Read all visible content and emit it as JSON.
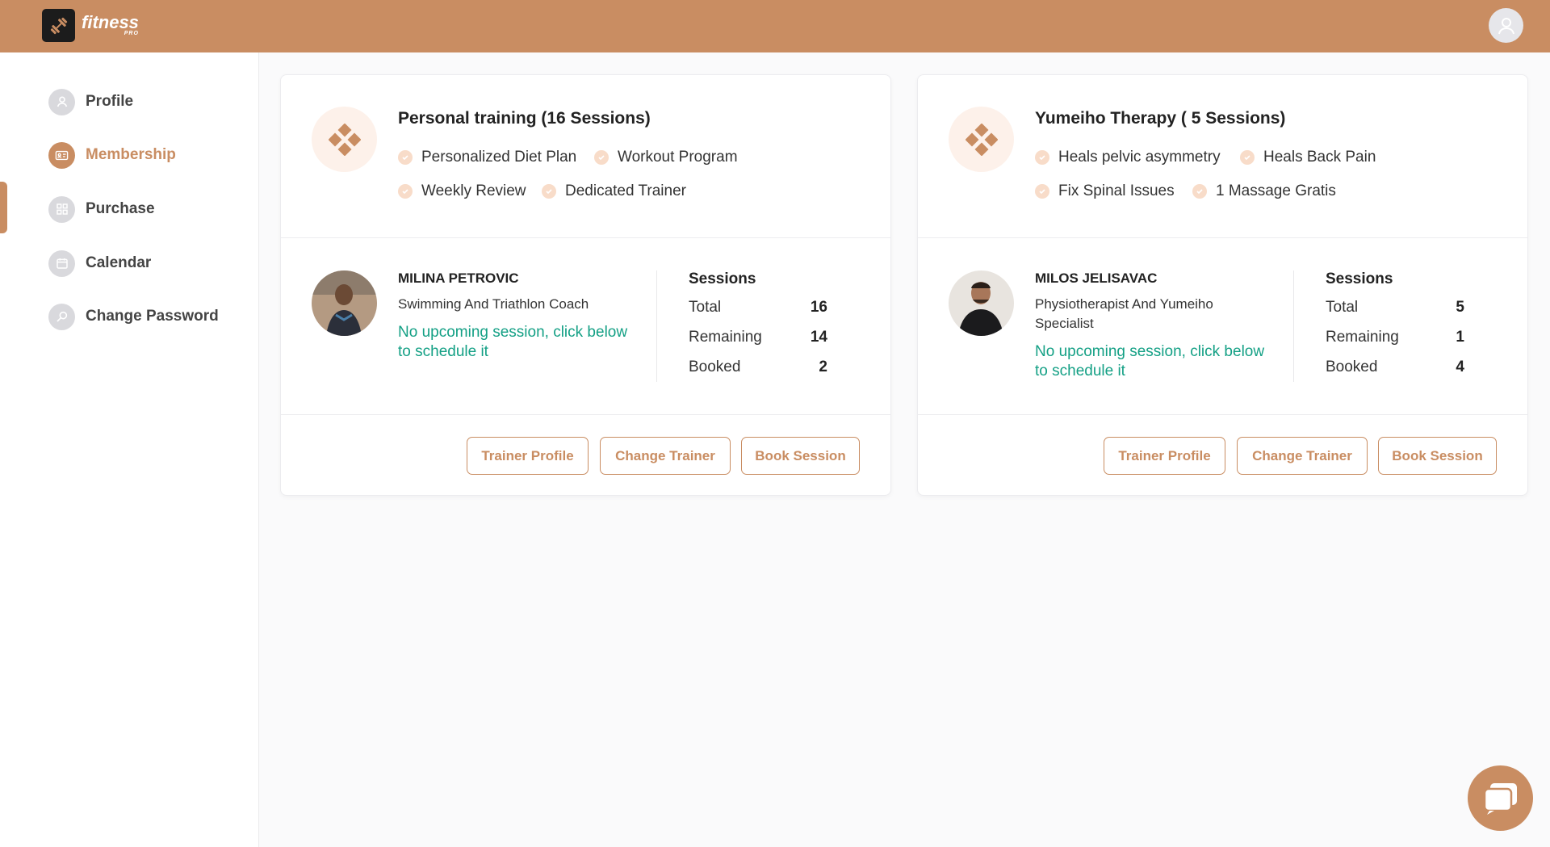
{
  "app": {
    "logo_text": "fitness",
    "logo_sub": "PRO"
  },
  "sidebar": {
    "items": [
      {
        "label": "Profile",
        "icon": "user-icon"
      },
      {
        "label": "Membership",
        "icon": "id-card-icon",
        "active": true
      },
      {
        "label": "Purchase",
        "icon": "grid-icon"
      },
      {
        "label": "Calendar",
        "icon": "calendar-icon"
      },
      {
        "label": "Change Password",
        "icon": "search-key-icon"
      }
    ]
  },
  "memberships": [
    {
      "title": "Personal training (16 Sessions)",
      "features": [
        "Personalized Diet Plan",
        "Workout Program",
        "Weekly Review",
        "Dedicated Trainer"
      ],
      "trainer": {
        "name": "MILINA PETROVIC",
        "role": "Swimming And Triathlon Coach",
        "note": "No upcoming session, click below to schedule it"
      },
      "sessions": {
        "title": "Sessions",
        "total_label": "Total",
        "total": "16",
        "remaining_label": "Remaining",
        "remaining": "14",
        "booked_label": "Booked",
        "booked": "2"
      },
      "buttons": {
        "profile": "Trainer Profile",
        "change": "Change Trainer",
        "book": "Book Session"
      }
    },
    {
      "title": "Yumeiho Therapy ( 5 Sessions)",
      "features": [
        "Heals pelvic asymmetry",
        "Heals Back Pain",
        "Fix Spinal Issues",
        "1 Massage Gratis"
      ],
      "trainer": {
        "name": "MILOS JELISAVAC",
        "role": "Physiotherapist And Yumeiho Specialist",
        "note": "No upcoming session, click below to schedule it"
      },
      "sessions": {
        "title": "Sessions",
        "total_label": "Total",
        "total": "5",
        "remaining_label": "Remaining",
        "remaining": "1",
        "booked_label": "Booked",
        "booked": "4"
      },
      "buttons": {
        "profile": "Trainer Profile",
        "change": "Change Trainer",
        "book": "Book Session"
      }
    }
  ],
  "colors": {
    "brand": "#c98d62",
    "success_text": "#14a085",
    "check_bg": "#f8dcc9"
  }
}
